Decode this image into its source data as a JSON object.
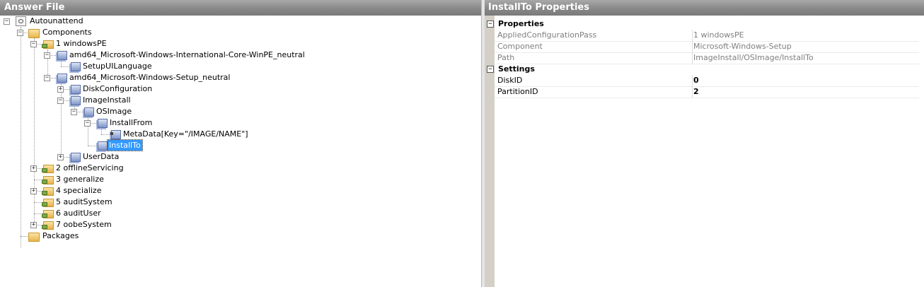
{
  "left_pane": {
    "title": "Answer File",
    "tree": {
      "root": "Autounattend",
      "components": "Components",
      "pass1": "1 windowsPE",
      "intl": "amd64_Microsoft-Windows-International-Core-WinPE_neutral",
      "setup_ui_language": "SetupUILanguage",
      "setup": "amd64_Microsoft-Windows-Setup_neutral",
      "disk_configuration": "DiskConfiguration",
      "image_install": "ImageInstall",
      "os_image": "OSImage",
      "install_from": "InstallFrom",
      "metadata": "MetaData[Key=\"/IMAGE/NAME\"]",
      "install_to": "InstallTo",
      "user_data": "UserData",
      "pass2": "2 offlineServicing",
      "pass3": "3 generalize",
      "pass4": "4 specialize",
      "pass5": "5 auditSystem",
      "pass6": "6 auditUser",
      "pass7": "7 oobeSystem",
      "packages": "Packages"
    }
  },
  "right_pane": {
    "title": "InstallTo Properties",
    "categories": {
      "properties": {
        "name": "Properties",
        "rows": [
          {
            "name": "AppliedConfigurationPass",
            "value": "1 windowsPE"
          },
          {
            "name": "Component",
            "value": "Microsoft-Windows-Setup"
          },
          {
            "name": "Path",
            "value": "ImageInstall/OSImage/InstallTo"
          }
        ]
      },
      "settings": {
        "name": "Settings",
        "rows": [
          {
            "name": "DiskID",
            "value": "0"
          },
          {
            "name": "PartitionID",
            "value": "2"
          }
        ]
      }
    }
  },
  "colors": {
    "header_gradient_top": "#a8a8a8",
    "selection": "#3399ff",
    "readonly_text": "#7f7f7f"
  }
}
